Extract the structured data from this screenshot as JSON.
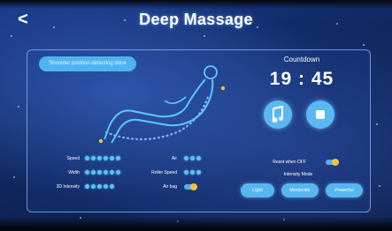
{
  "header": {
    "back_icon": "chevron-left-icon",
    "back_glyph": "<",
    "title": "Deep Massage"
  },
  "status_pill": {
    "label": "Shoulder position detecting done"
  },
  "countdown": {
    "label": "Countdown",
    "time": "19 : 45"
  },
  "actions": {
    "music_icon": "music-note-icon",
    "stop_icon": "stop-icon"
  },
  "controls": {
    "speed": {
      "label": "Speed",
      "level": 6,
      "max": 6
    },
    "width": {
      "label": "Width",
      "level": 6,
      "max": 6
    },
    "intensity_3d": {
      "label": "3D Intensity",
      "level": 5,
      "max": 5
    },
    "air": {
      "label": "Air",
      "level": 3,
      "max": 3
    },
    "roller_speed": {
      "label": "Roller Speed",
      "level": 3,
      "max": 3
    },
    "air_bag": {
      "label": "Air bag",
      "on": true
    },
    "heat_when_off": {
      "label": "Reset when OFF",
      "on": true
    }
  },
  "intensity_mode": {
    "label": "Intensity Mode",
    "options": [
      "Light",
      "Moderate",
      "Powerful"
    ]
  },
  "colors": {
    "accent": "#56b6f0",
    "dot": "#58c4f6",
    "toggle_knob": "#f2c33a",
    "background": "#10285f"
  }
}
